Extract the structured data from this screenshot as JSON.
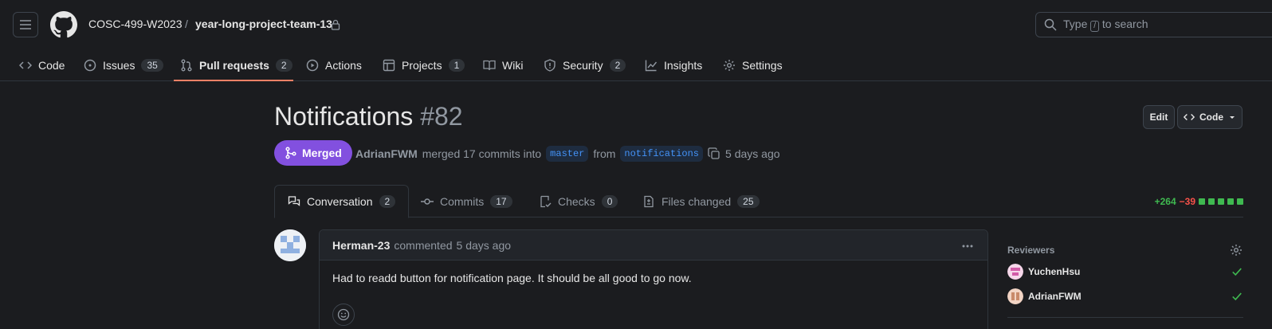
{
  "header": {
    "owner": "COSC-499-W2023",
    "separator": "/",
    "repo": "year-long-project-team-13",
    "search_prefix": "Type",
    "search_key": "/",
    "search_suffix": "to search"
  },
  "nav": [
    {
      "label": "Code"
    },
    {
      "label": "Issues",
      "count": "35"
    },
    {
      "label": "Pull requests",
      "count": "2"
    },
    {
      "label": "Actions"
    },
    {
      "label": "Projects",
      "count": "1"
    },
    {
      "label": "Wiki"
    },
    {
      "label": "Security",
      "count": "2"
    },
    {
      "label": "Insights"
    },
    {
      "label": "Settings"
    }
  ],
  "pr": {
    "title": "Notifications",
    "number": "#82",
    "edit_label": "Edit",
    "code_label": "Code",
    "state": "Merged",
    "author": "AdrianFWM",
    "merged_text": "merged 17 commits into",
    "base": "master",
    "from_text": "from",
    "head": "notifications",
    "time": "5 days ago"
  },
  "prtabs": [
    {
      "label": "Conversation",
      "count": "2"
    },
    {
      "label": "Commits",
      "count": "17"
    },
    {
      "label": "Checks",
      "count": "0"
    },
    {
      "label": "Files changed",
      "count": "25"
    }
  ],
  "diff": {
    "additions": "+264",
    "deletions": "−39"
  },
  "comment": {
    "author": "Herman-23",
    "action": "commented",
    "time": "5 days ago",
    "body": "Had to readd button for notification page. It should be all good to go now."
  },
  "sidebar": {
    "reviewers_title": "Reviewers",
    "reviewers": [
      {
        "name": "YuchenHsu"
      },
      {
        "name": "AdrianFWM"
      }
    ]
  },
  "colors": {
    "accent": "#f78166",
    "merged": "#8250df",
    "green": "#3fb950",
    "red": "#f85149",
    "link": "#4493f8"
  }
}
